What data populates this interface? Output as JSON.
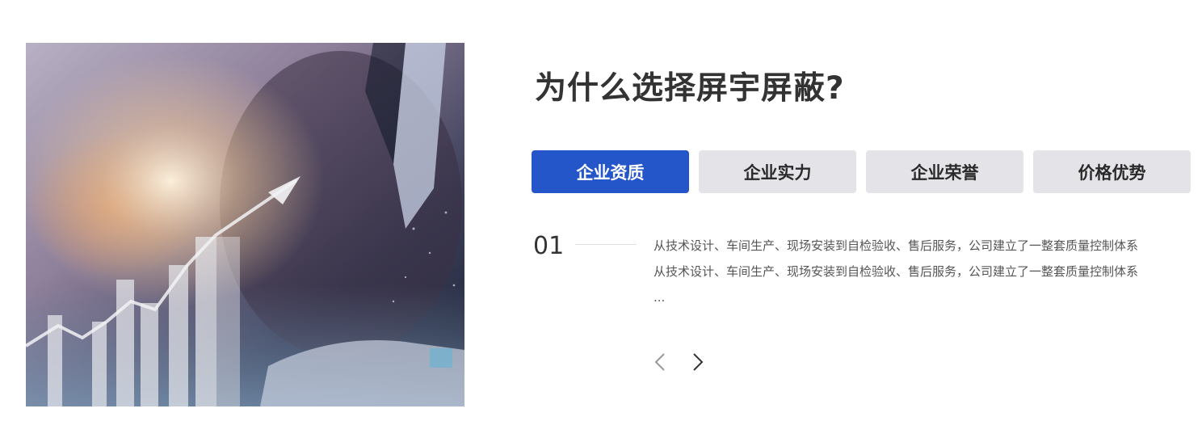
{
  "section": {
    "title": "为什么选择屏宇屏蔽?"
  },
  "tabs": [
    {
      "label": "企业资质",
      "active": true
    },
    {
      "label": "企业实力",
      "active": false
    },
    {
      "label": "企业荣誉",
      "active": false
    },
    {
      "label": "价格优势",
      "active": false
    }
  ],
  "item": {
    "number": "01",
    "lines": [
      "从技术设计、车间生产、现场安装到自检验收、售后服务，公司建立了一整套质量控制体系",
      "从技术设计、车间生产、现场安装到自检验收、售后服务，公司建立了一整套质量控制体系",
      "..."
    ]
  },
  "navigation": {
    "prev_icon": "chevron-left-icon",
    "next_icon": "chevron-right-icon"
  },
  "colors": {
    "accent": "#2456c9",
    "tab_inactive": "#e3e3e8",
    "title": "#333333",
    "body_text": "#555555"
  }
}
